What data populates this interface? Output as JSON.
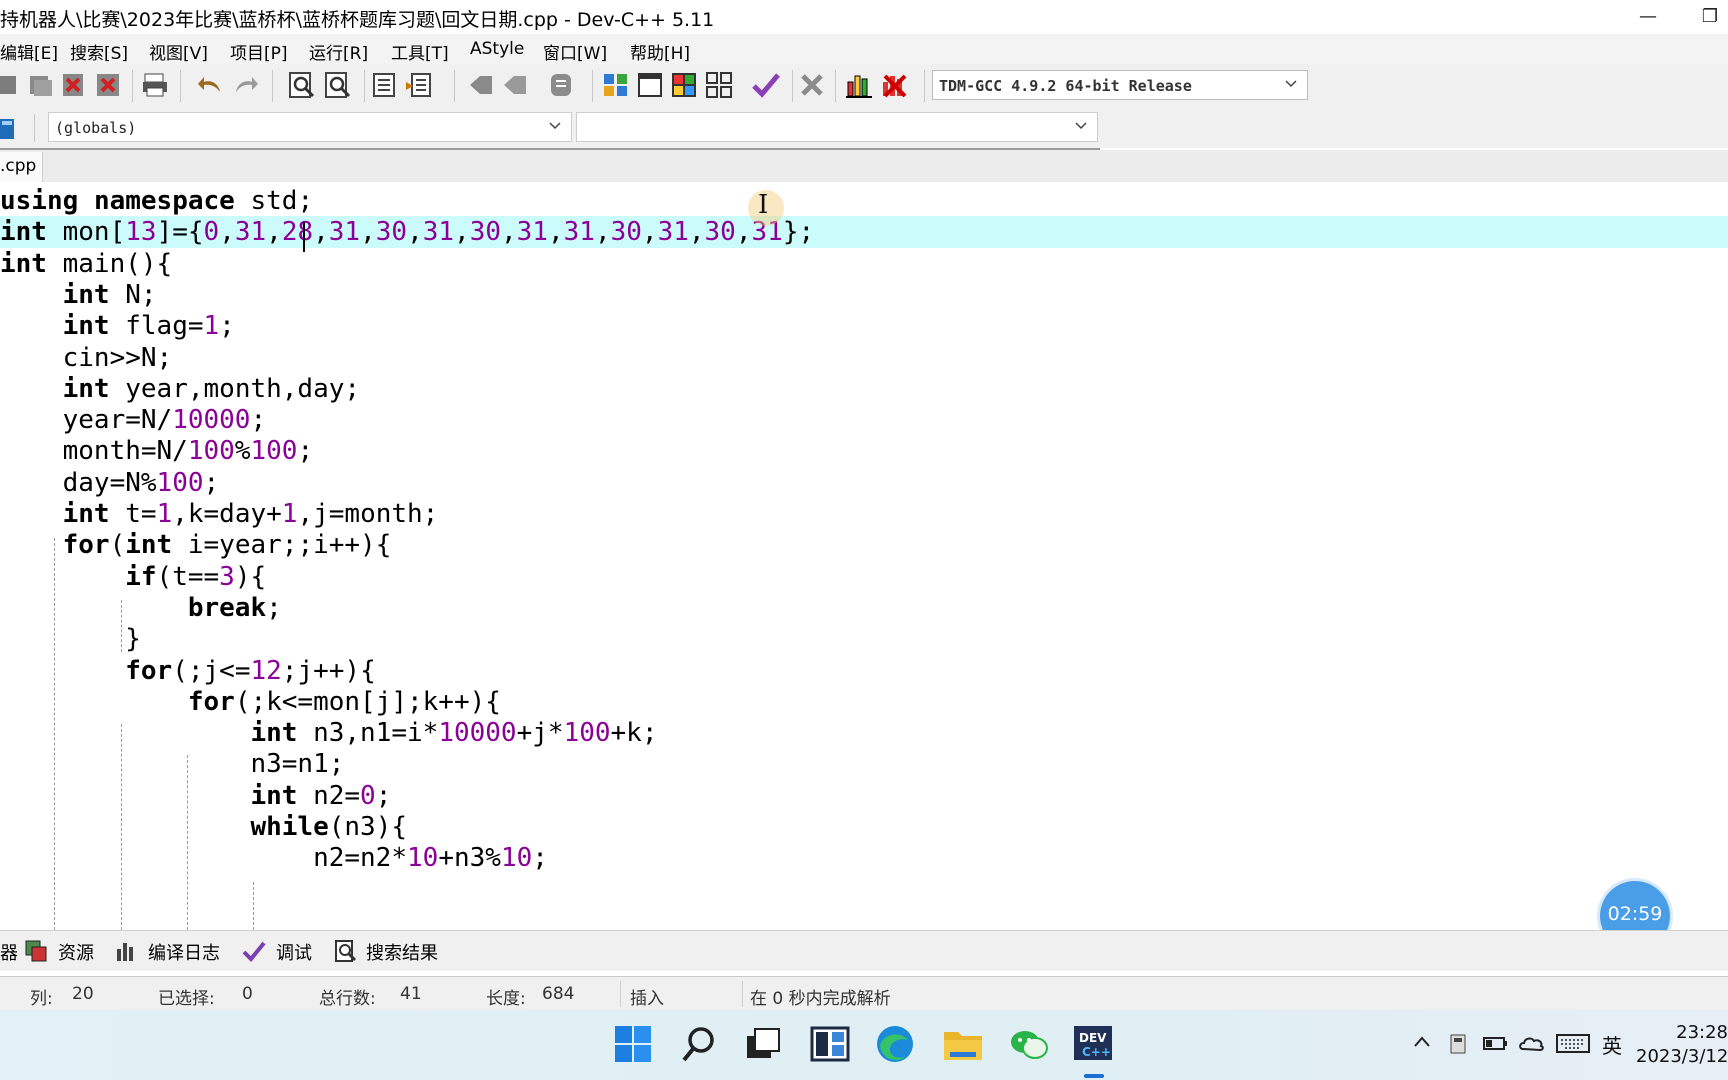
{
  "window": {
    "title": "持机器人\\比赛\\2023年比赛\\蓝桥杯\\蓝桥杯题库习题\\回文日期.cpp - Dev-C++ 5.11",
    "minimize": "—",
    "restore": "❐"
  },
  "menu": [
    "编辑[E]",
    "搜索[S]",
    "视图[V]",
    "项目[P]",
    "运行[R]",
    "工具[T]",
    "AStyle",
    "窗口[W]",
    "帮助[H]"
  ],
  "toolbar": {
    "compiler": "TDM-GCC 4.9.2 64-bit Release"
  },
  "classbar": {
    "scope": "(globals)",
    "member": ""
  },
  "tab": {
    "label": ".cpp"
  },
  "editor": {
    "lines": [
      "using namespace std;",
      "int mon[13]={0,31,28,31,30,31,30,31,31,30,31,30,31};",
      "int main(){",
      "    int N;",
      "    int flag=1;",
      "    cin>>N;",
      "    int year,month,day;",
      "    year=N/10000;",
      "    month=N/100%100;",
      "    day=N%100;",
      "    int t=1,k=day+1,j=month;",
      "    for(int i=year;;i++){",
      "        if(t==3){",
      "            break;",
      "        }",
      "        for(;j<=12;j++){",
      "            for(;k<=mon[j];k++){",
      "                int n3,n1=i*10000+j*100+k;",
      "                n3=n1;",
      "                int n2=0;",
      "                while(n3){",
      "                    n2=n2*10+n3%10;"
    ],
    "highlight_line": 2,
    "cursor_icon": "I"
  },
  "timer": "02:59",
  "panel_tabs": [
    "器",
    "资源",
    "编译日志",
    "调试",
    "搜索结果"
  ],
  "status": {
    "col_label": "列:",
    "col_value": "20",
    "sel_label": "已选择:",
    "sel_value": "0",
    "lines_label": "总行数:",
    "lines_value": "41",
    "len_label": "长度:",
    "len_value": "684",
    "mode": "插入",
    "parse": "在 0 秒内完成解析"
  },
  "taskbar": {
    "apps": [
      "start-icon",
      "search-icon",
      "task-view-icon",
      "widgets-icon",
      "edge-icon",
      "file-explorer-icon",
      "wechat-icon",
      "devcpp-icon"
    ],
    "tray_ime": "英",
    "time": "23:28",
    "date": "2023/3/12"
  },
  "colors": {
    "highlight": "#ccfbfb",
    "number": "#8b0096",
    "timer": "#4a9ee8"
  }
}
